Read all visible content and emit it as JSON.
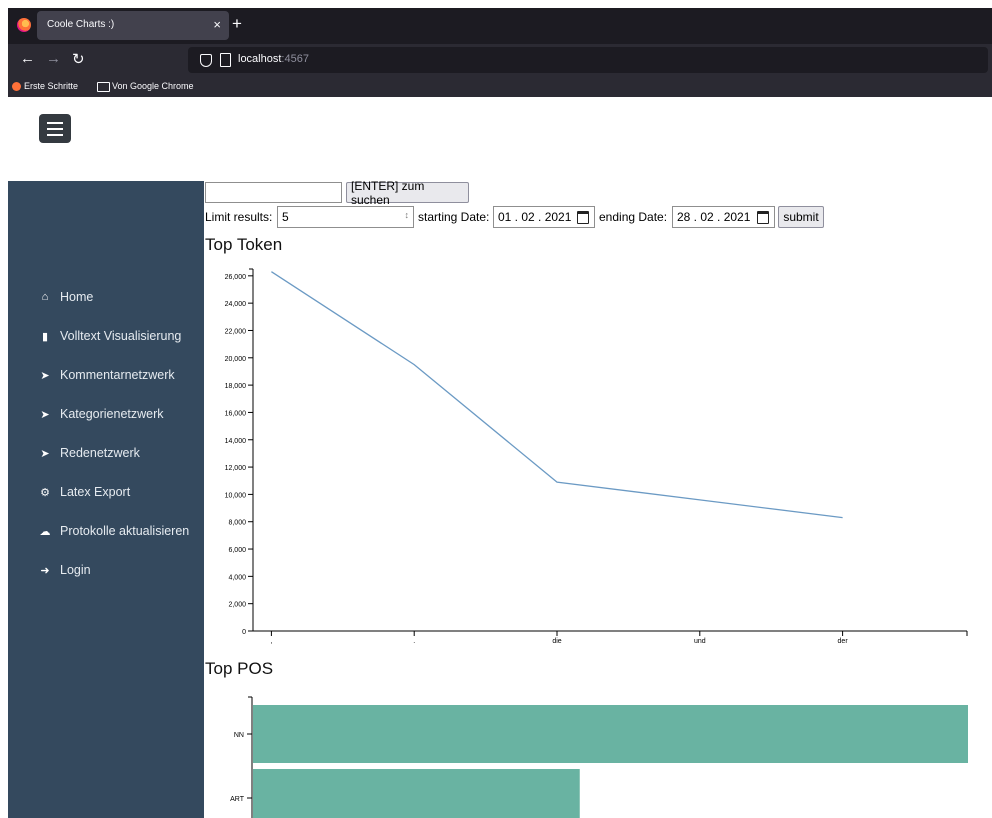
{
  "browser": {
    "tab_title": "Coole Charts :)",
    "tab_close": "×",
    "new_tab": "+",
    "url_host": "localhost",
    "url_port": ":4567",
    "bookmarks": [
      "Erste Schritte",
      "Von Google Chrome"
    ]
  },
  "sidebar": {
    "items": [
      {
        "label": "Home",
        "icon": "home-icon"
      },
      {
        "label": "Volltext Visualisierung",
        "icon": "file-icon"
      },
      {
        "label": "Kommentarnetzwerk",
        "icon": "send-icon"
      },
      {
        "label": "Kategorienetzwerk",
        "icon": "send-icon"
      },
      {
        "label": "Redenetzwerk",
        "icon": "send-icon"
      },
      {
        "label": "Latex Export",
        "icon": "gears-icon"
      },
      {
        "label": "Protokolle aktualisieren",
        "icon": "cloud-upload-icon"
      },
      {
        "label": "Login",
        "icon": "sign-in-icon"
      }
    ]
  },
  "search": {
    "value": "",
    "button_label": "[ENTER] zum suchen"
  },
  "filters": {
    "limit_label": "Limit results:",
    "limit_value": "5",
    "start_label": "starting Date:",
    "start_value": "01 . 02 . 2021",
    "end_label": "ending Date:",
    "end_value": "28 . 02 . 2021",
    "submit_label": "submit"
  },
  "colors": {
    "sidebar_bg": "#34495e",
    "line": "#6b9ac4",
    "bar": "#69b3a2"
  },
  "chart_data": [
    {
      "type": "line",
      "title": "Top Token",
      "categories": [
        ",",
        ".",
        "die",
        "und",
        "der"
      ],
      "values": [
        26300,
        19500,
        10900,
        9600,
        8300
      ],
      "ylim": [
        0,
        26500
      ],
      "yticks": [
        0,
        2000,
        4000,
        6000,
        8000,
        10000,
        12000,
        14000,
        16000,
        18000,
        20000,
        22000,
        24000,
        26000
      ],
      "grid": false
    },
    {
      "type": "bar",
      "orientation": "horizontal",
      "title": "Top POS",
      "categories": [
        "NN",
        "ART"
      ],
      "values": [
        1.0,
        0.457
      ],
      "grid": false
    }
  ]
}
